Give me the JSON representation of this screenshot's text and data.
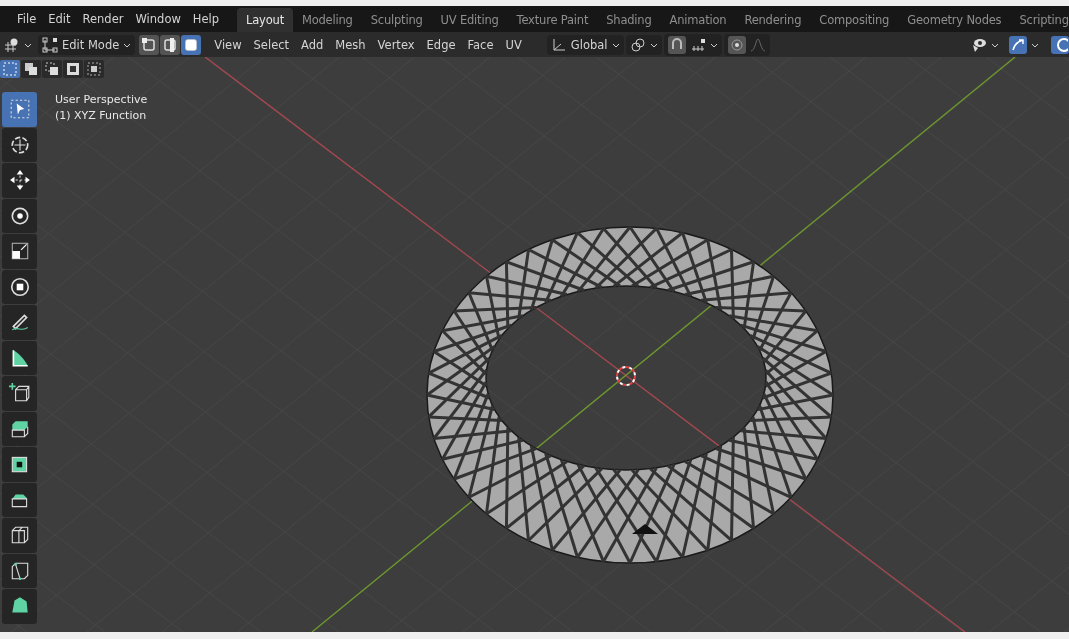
{
  "menu": [
    "File",
    "Edit",
    "Render",
    "Window",
    "Help"
  ],
  "workspaces": [
    {
      "label": "Layout",
      "selected": true
    },
    {
      "label": "Modeling",
      "selected": false
    },
    {
      "label": "Sculpting",
      "selected": false
    },
    {
      "label": "UV Editing",
      "selected": false
    },
    {
      "label": "Texture Paint",
      "selected": false
    },
    {
      "label": "Shading",
      "selected": false
    },
    {
      "label": "Animation",
      "selected": false
    },
    {
      "label": "Rendering",
      "selected": false
    },
    {
      "label": "Compositing",
      "selected": false
    },
    {
      "label": "Geometry Nodes",
      "selected": false
    },
    {
      "label": "Scripting",
      "selected": false
    }
  ],
  "header": {
    "mode": "Edit Mode",
    "select_modes": [
      {
        "kind": "vertex",
        "selected": false
      },
      {
        "kind": "edge",
        "selected": false
      },
      {
        "kind": "face",
        "selected": true
      }
    ],
    "menus": [
      "View",
      "Select",
      "Add",
      "Mesh",
      "Vertex",
      "Edge",
      "Face",
      "UV"
    ],
    "orientation": "Global"
  },
  "box_modes": [
    {
      "kind": "new",
      "selected": true
    },
    {
      "kind": "extend",
      "selected": false
    },
    {
      "kind": "subtract",
      "selected": false
    },
    {
      "kind": "invert",
      "selected": false
    },
    {
      "kind": "intersect",
      "selected": false
    }
  ],
  "viewport": {
    "view_name": "User Perspective",
    "object_name": "(1) XYZ Function"
  },
  "tools": [
    {
      "kind": "select",
      "selected": true
    },
    {
      "kind": "cursor",
      "selected": false
    },
    {
      "kind": "move",
      "selected": false
    },
    {
      "kind": "rotate",
      "selected": false
    },
    {
      "kind": "scale",
      "selected": false
    },
    {
      "kind": "transform",
      "selected": false
    },
    {
      "kind": "annotate",
      "selected": false
    },
    {
      "kind": "measure",
      "selected": false
    },
    {
      "kind": "add-cube",
      "selected": false
    },
    {
      "kind": "extrude",
      "selected": false
    },
    {
      "kind": "inset",
      "selected": false
    },
    {
      "kind": "bevel",
      "selected": false
    },
    {
      "kind": "loop-cut",
      "selected": false
    },
    {
      "kind": "knife",
      "selected": false
    },
    {
      "kind": "poly-build",
      "selected": false
    }
  ]
}
